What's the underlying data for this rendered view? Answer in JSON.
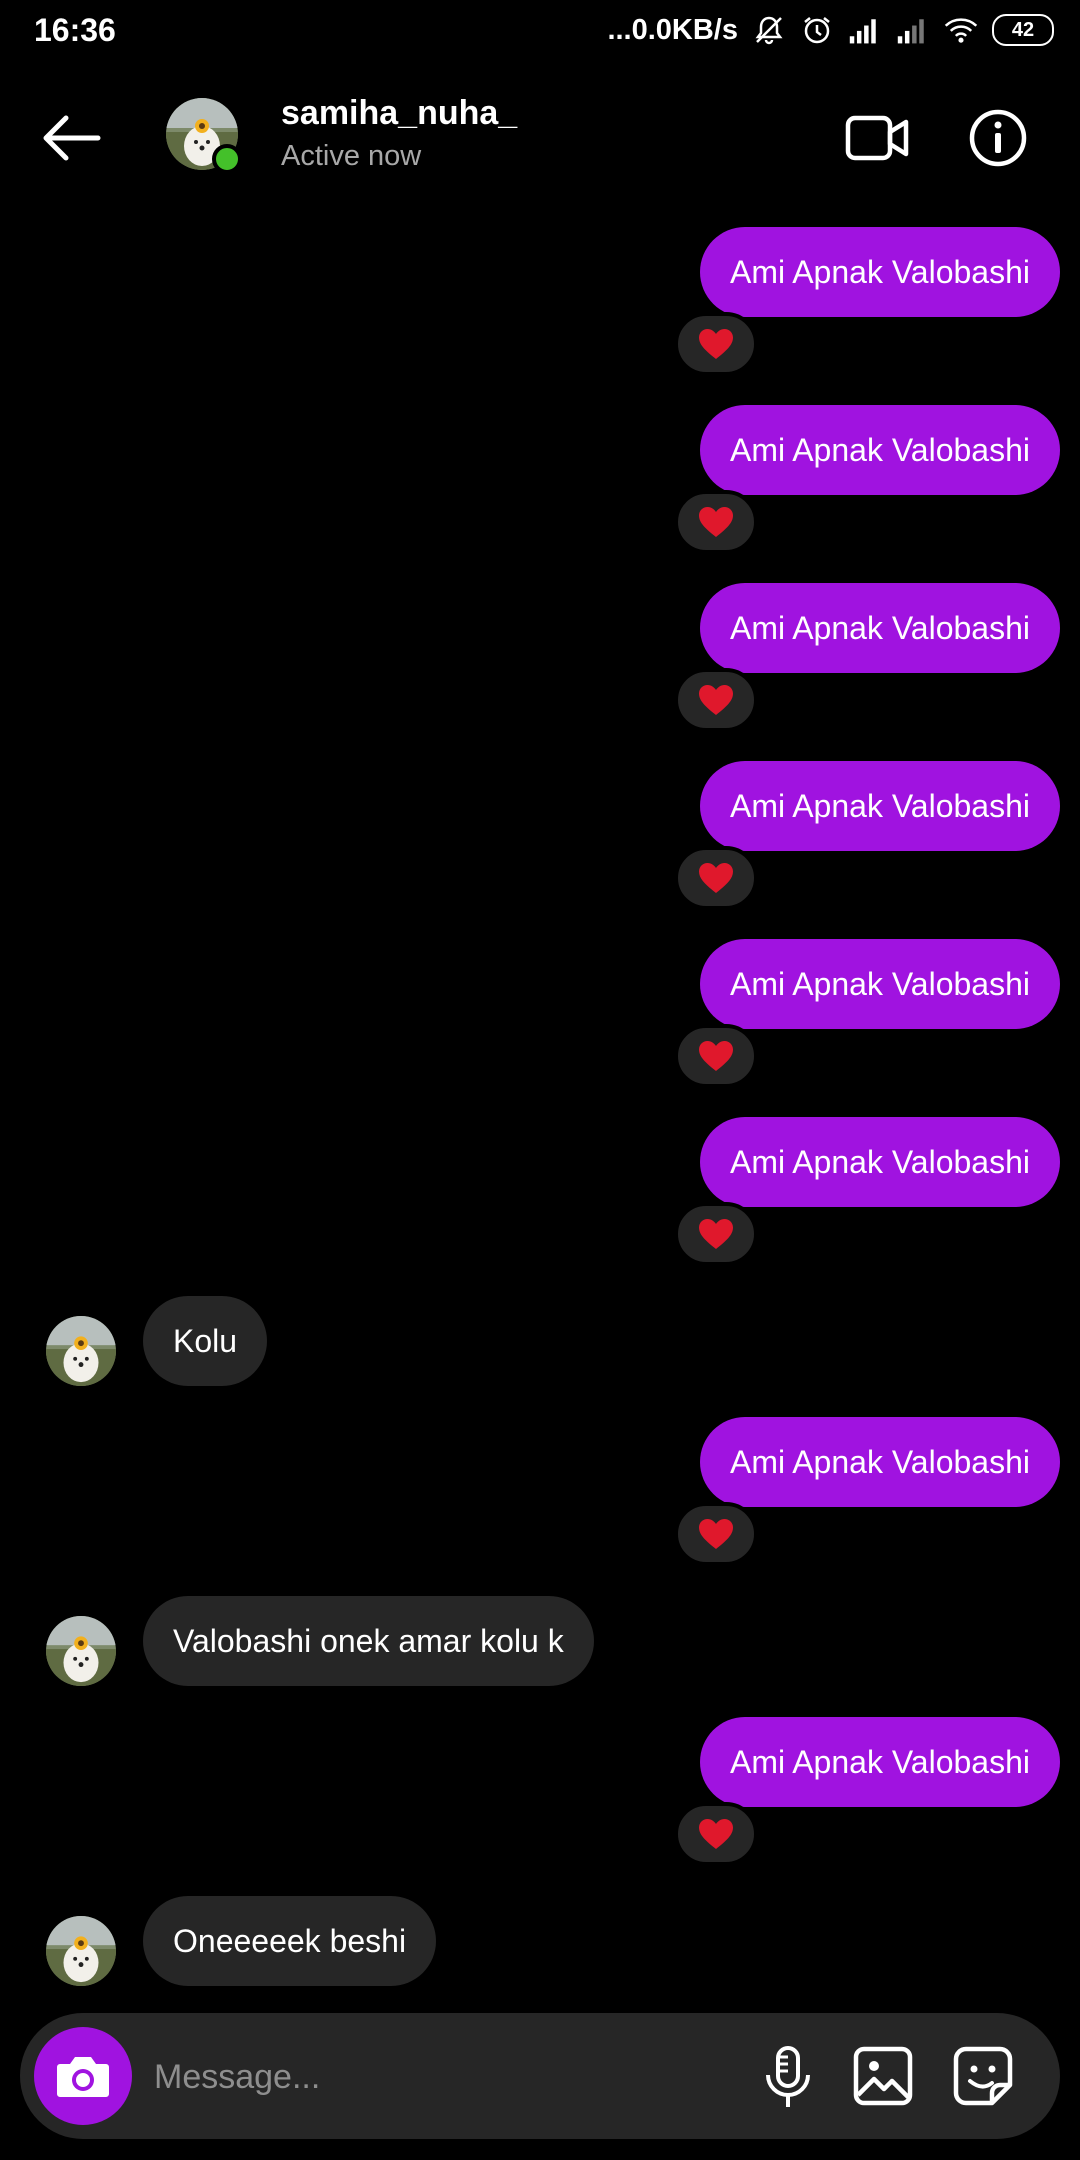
{
  "status_bar": {
    "time": "16:36",
    "speed": "...0.0KB/s",
    "battery": "42"
  },
  "header": {
    "username": "samiha_nuha_",
    "status": "Active now"
  },
  "messages": {
    "m1": "Ami Apnak Valobashi",
    "m2": "Ami Apnak Valobashi",
    "m3": "Ami Apnak Valobashi",
    "m4": "Ami Apnak Valobashi",
    "m5": "Ami Apnak Valobashi",
    "m6": "Ami Apnak Valobashi",
    "in1": "Kolu",
    "m7": "Ami Apnak Valobashi",
    "in2": "Valobashi onek amar kolu k",
    "m8": "Ami Apnak Valobashi",
    "in3": "Oneeeeek beshi"
  },
  "reaction_icon": "red-heart",
  "composer": {
    "placeholder": "Message..."
  },
  "colors": {
    "outgoing_bubble": "#a013e0",
    "incoming_bubble": "#262626",
    "online": "#44c02a"
  }
}
